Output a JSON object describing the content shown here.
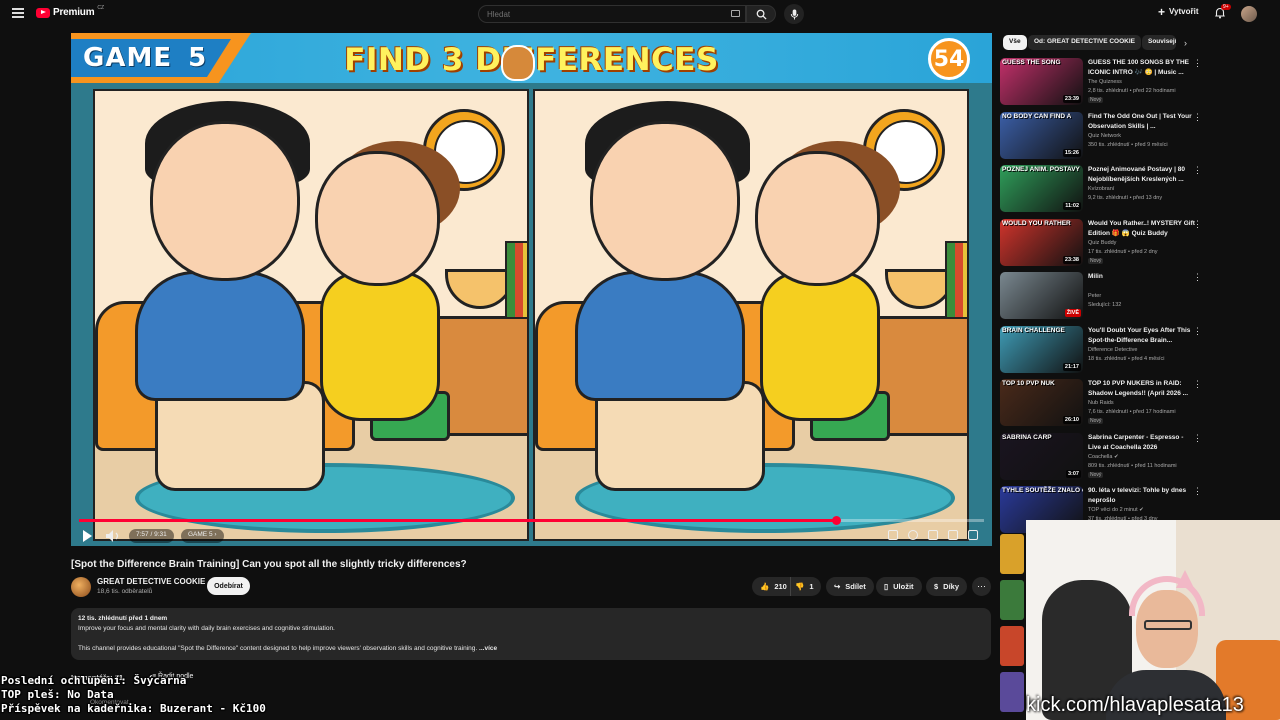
{
  "header": {
    "logo_text": "Premium",
    "logo_country": "CZ",
    "search_placeholder": "Hledat",
    "create_label": "Vytvořit",
    "notification_count": "9+"
  },
  "player": {
    "game_label": "GAME",
    "game_number": "5",
    "puzzle_title": "FIND 3 DIFFERENCES",
    "countdown": "54",
    "time_display": "7:57 / 9:31",
    "chapter_label": "GAME 5",
    "progress": 0.836
  },
  "video": {
    "title": "[Spot the Difference Brain Training] Can you spot all the slightly tricky differences?",
    "channel_name": "GREAT DETECTIVE COOKIE",
    "channel_subs": "18,6 tis. odběratelů",
    "subscribe_label": "Odebírat",
    "likes": "210",
    "dislikes": "1",
    "share_label": "Sdílet",
    "save_label": "Uložit",
    "thanks_label": "Díky",
    "desc_meta": "12 tis. zhlédnutí  před 1 dnem",
    "desc_line1": "Improve your focus and mental clarity with daily brain exercises and cognitive stimulation.",
    "desc_line2": "This channel provides educational \"Spot the Difference\" content designed to help improve viewers' observation skills and cognitive training.",
    "desc_more": "...více",
    "comments_label": "Komentáře: 21",
    "sort_label": "Řadit podle",
    "comment_placeholder": "Okomentovat..."
  },
  "sidebar": {
    "chips": [
      "Vše",
      "Od: GREAT DETECTIVE COOKIE",
      "Souvisejí"
    ],
    "items": [
      {
        "title": "GUESS THE 100 SONGS BY THE ICONIC INTRO 🎶 😳 | Music ...",
        "channel": "The Quizness",
        "stats": "2,8 tis. zhlédnutí • před 22 hodinami",
        "badge": "Nový",
        "duration": "23:39",
        "thumb_text": "GUESS THE SONG",
        "thumb_color": "#c2306a"
      },
      {
        "title": "Find The Odd One Out | Test Your Observation Skills | ...",
        "channel": "Quiz Network",
        "stats": "350 tis. zhlédnutí • před 9 měsíci",
        "badge": "",
        "duration": "15:26",
        "thumb_text": "NO BODY CAN FIND A",
        "thumb_color": "#3b5fa8"
      },
      {
        "title": "Poznej Animované Postavy | 80 Nejoblíbenějších Kreslených ...",
        "channel": "Kvízobraní",
        "stats": "9,2 tis. zhlédnutí • před 13 dny",
        "badge": "",
        "duration": "11:02",
        "thumb_text": "POZNEJ ANIM. POSTAVY",
        "thumb_color": "#2f9e5a"
      },
      {
        "title": "Would You Rather..! MYSTERY Gift Edition 🎁 😱 Quiz Buddy",
        "channel": "Quiz Buddy",
        "stats": "17 tis. zhlédnutí • před 2 dny",
        "badge": "Nový",
        "duration": "23:38",
        "thumb_text": "WOULD YOU RATHER",
        "thumb_color": "#d0342c"
      },
      {
        "title": "Milin",
        "channel": "Peter",
        "stats": "Sledující: 132",
        "badge": "",
        "duration": "ŽIVĚ",
        "thumb_text": "",
        "thumb_color": "#7a8890"
      },
      {
        "title": "You'll Doubt Your Eyes After This Spot-the-Difference Brain...",
        "channel": "Difference Detective",
        "stats": "18 tis. zhlédnutí • před 4 měsíci",
        "badge": "",
        "duration": "21:17",
        "thumb_text": "BRAIN CHALLENGE",
        "thumb_color": "#3e9bb5"
      },
      {
        "title": "TOP 10 PVP NUKERS in RAID: Shadow Legends!! (April 2026 ...",
        "channel": "Nub Raids",
        "stats": "7,6 tis. zhlédnutí • před 17 hodinami",
        "badge": "Nový",
        "duration": "26:10",
        "thumb_text": "TOP 10 PVP NUK",
        "thumb_color": "#4a2a1a"
      },
      {
        "title": "Sabrina Carpenter - Espresso - Live at Coachella 2026",
        "channel": "Coachella ✔",
        "stats": "809 tis. zhlédnutí • před 11 hodinami",
        "badge": "Nový",
        "duration": "3:07",
        "thumb_text": "SABRINA CARP",
        "thumb_color": "#1a1420"
      },
      {
        "title": "90. léta v televizi: Tohle by dnes neprošlo",
        "channel": "TOP věci do 2 minut ✔",
        "stats": "37 tis. zhlédnutí • před 3 dny",
        "badge": "",
        "duration": "",
        "thumb_text": "TYHLE SOUTĚŽE ZNALO CELÉ ČESKO",
        "thumb_color": "#2a3a9a"
      }
    ]
  },
  "overlay": {
    "line1": "Poslední ochlupení: Švýcarna",
    "line2": "TOP pleš: No Data",
    "line3": "Příspěvek na kadeřnika: Buzerant - Kč100",
    "kick_url": "kick.com/hlavaplesata13"
  },
  "colors": {
    "accent": "#ff0033",
    "background": "#0f0f0f",
    "pill": "#272727"
  }
}
